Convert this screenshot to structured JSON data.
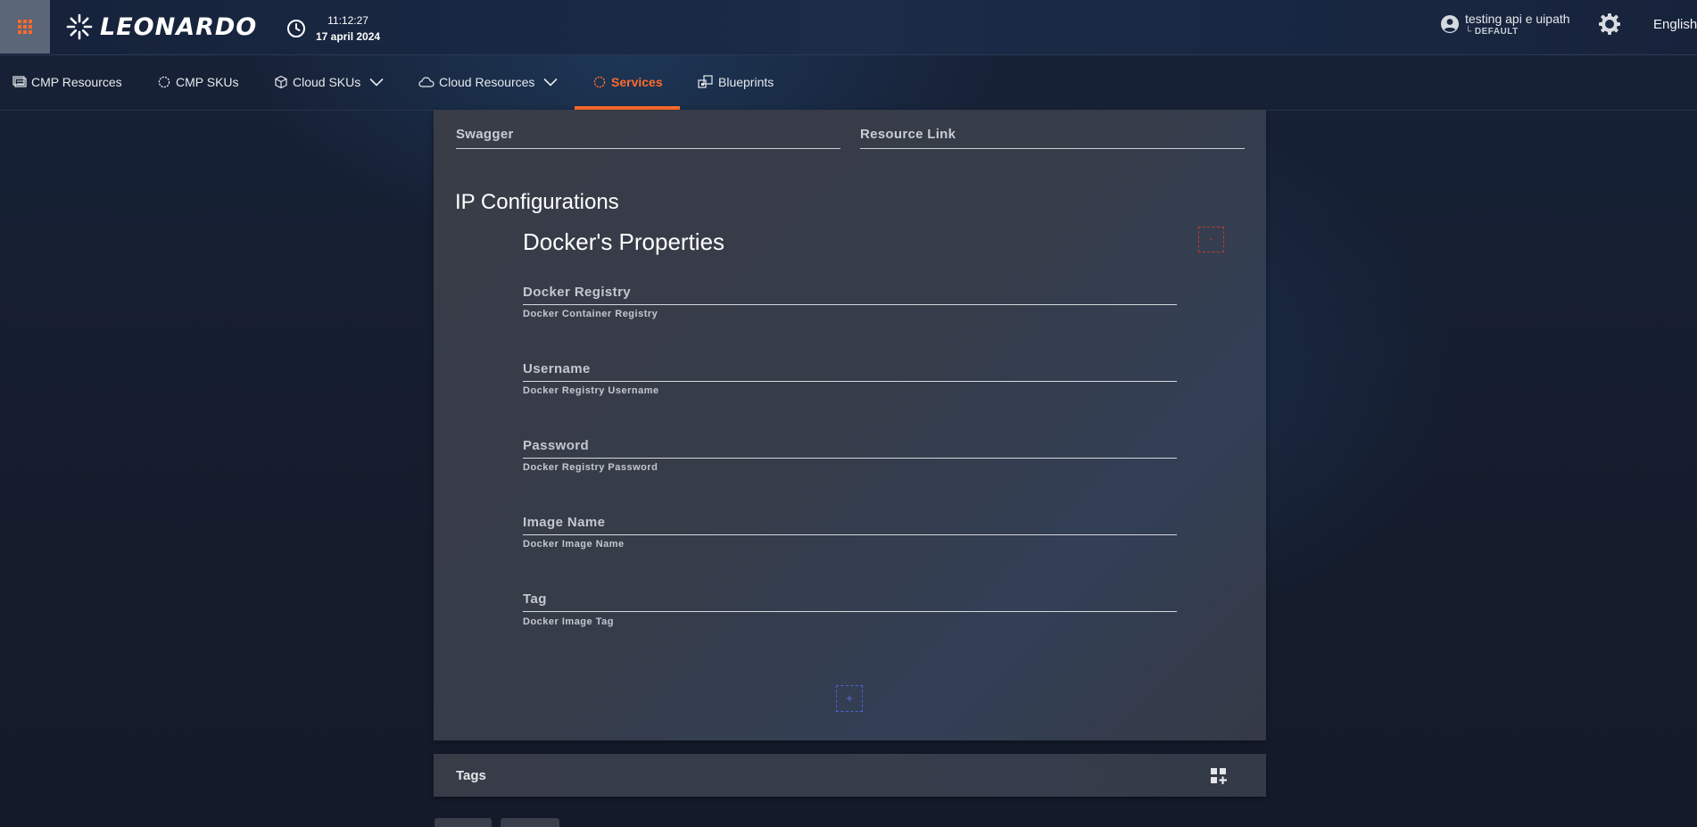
{
  "header": {
    "brand": "LEONARDO",
    "time": "11:12:27",
    "date": "17 april 2024",
    "user_name": "testing api e uipath",
    "user_tenant": "DEFAULT",
    "language": "English"
  },
  "nav": {
    "items": [
      {
        "label": "CMP Resources",
        "icon": "server-list-icon"
      },
      {
        "label": "CMP SKUs",
        "icon": "gear-outline-icon"
      },
      {
        "label": "Cloud SKUs",
        "icon": "package-icon",
        "dropdown": true
      },
      {
        "label": "Cloud Resources",
        "icon": "cloud-icon",
        "dropdown": true
      },
      {
        "label": "Services",
        "icon": "gear-outline-icon",
        "active": true
      },
      {
        "label": "Blueprints",
        "icon": "blueprint-icon"
      }
    ]
  },
  "form": {
    "swagger_label": "Swagger",
    "resource_link_label": "Resource Link",
    "section_title": "IP Configurations",
    "subsection_title": "Docker's Properties",
    "remove_label": "-",
    "add_label": "+",
    "fields": [
      {
        "label": "Docker Registry",
        "hint": "Docker Container Registry"
      },
      {
        "label": "Username",
        "hint": "Docker Registry Username"
      },
      {
        "label": "Password",
        "hint": "Docker Registry Password"
      },
      {
        "label": "Image Name",
        "hint": "Docker Image Name"
      },
      {
        "label": "Tag",
        "hint": "Docker Image Tag"
      }
    ]
  },
  "tags": {
    "label": "Tags"
  },
  "colors": {
    "accent": "#ff6b2c",
    "remove": "#c0392b",
    "add": "#4f63d8"
  }
}
